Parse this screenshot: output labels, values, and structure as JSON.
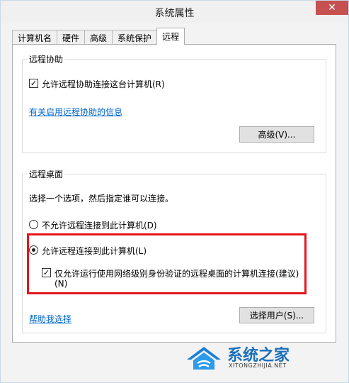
{
  "window": {
    "title": "系统属性",
    "close_glyph": "✕"
  },
  "tabs": [
    "计算机名",
    "硬件",
    "高级",
    "系统保护",
    "远程"
  ],
  "remote_assistance": {
    "group_label": "远程协助",
    "allow_checkbox_label": "允许远程协助连接这台计算机(R)",
    "allow_checked": true,
    "info_link": "有关启用远程协助的信息",
    "advanced_button": "高级(V)..."
  },
  "remote_desktop": {
    "group_label": "远程桌面",
    "instruction": "选择一个选项，然后指定谁可以连接。",
    "option_deny": "不允许远程连接到此计算机(D)",
    "option_allow": "允许远程连接到此计算机(L)",
    "nla_label_line1": "仅允许运行使用网络级别身份验证的远程桌面的计算机连接(建议)",
    "nla_label_line2": "(N)",
    "nla_checked": true,
    "help_link": "帮助我选择",
    "select_users_button": "选择用户(S)..."
  },
  "watermark": {
    "brand": "系统之家",
    "url": "XITONGZHIJIA.NET"
  },
  "colors": {
    "highlight": "#e4161b",
    "link": "#0066cc",
    "close": "#c75050"
  }
}
